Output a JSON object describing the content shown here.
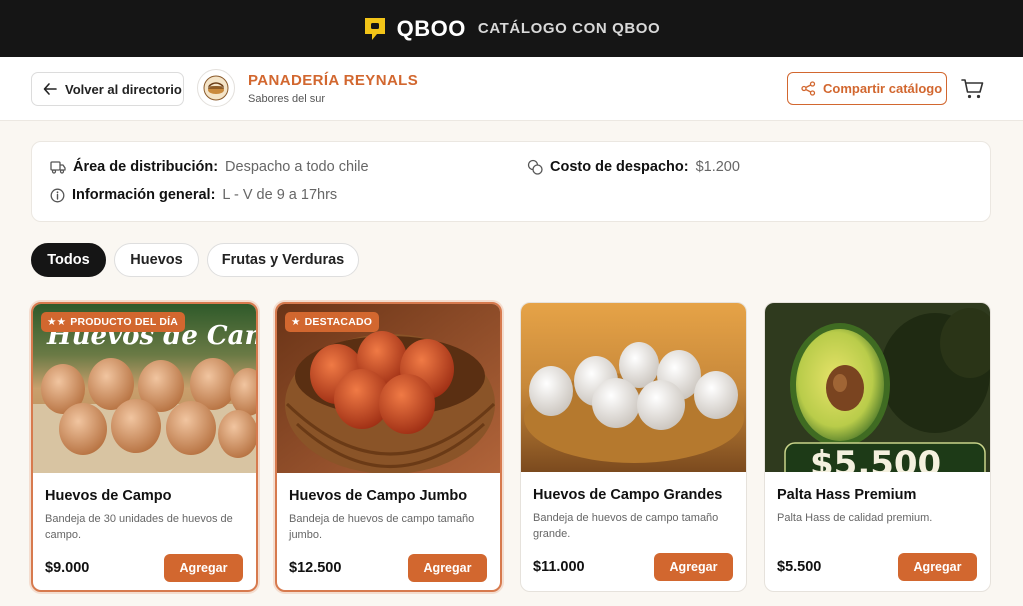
{
  "topbar": {
    "brand": "QBOO",
    "subtitle": "CATÁLOGO CON QBOO",
    "logo_icon": "speech-bubble-icon",
    "accent": "#f2c418"
  },
  "header": {
    "back_label": "Volver al directorio",
    "store_name": "PANADERÍA REYNALS",
    "store_tagline": "Sabores del sur",
    "share_label": "Compartir catálogo",
    "cart_icon": "cart-icon",
    "brand_color": "#d2672f"
  },
  "info": {
    "distribution_label": "Área de distribución:",
    "distribution_value": "Despacho a todo chile",
    "shipping_label": "Costo de despacho:",
    "shipping_value": "$1.200",
    "general_label": "Información general:",
    "general_value": "L - V de 9 a 17hrs"
  },
  "tabs": [
    {
      "label": "Todos",
      "active": true
    },
    {
      "label": "Huevos",
      "active": false
    },
    {
      "label": "Frutas y Verduras",
      "active": false
    }
  ],
  "products": [
    {
      "name": "Huevos de Campo",
      "description": "Bandeja de 30 unidades de huevos de campo.",
      "price": "$9.000",
      "button": "Agregar",
      "badge": "PRODUCTO DEL DÍA",
      "image_text": "Huevos de Campo"
    },
    {
      "name": "Huevos de Campo Jumbo",
      "description": "Bandeja de huevos de campo tamaño jumbo.",
      "price": "$12.500",
      "button": "Agregar",
      "badge": "DESTACADO"
    },
    {
      "name": "Huevos de Campo Grandes",
      "description": "Bandeja de huevos de campo tamaño grande.",
      "price": "$11.000",
      "button": "Agregar"
    },
    {
      "name": "Palta Hass Premium",
      "description": "Palta Hass de calidad premium.",
      "price": "$5.500",
      "button": "Agregar",
      "image_text": "$5.500"
    }
  ]
}
